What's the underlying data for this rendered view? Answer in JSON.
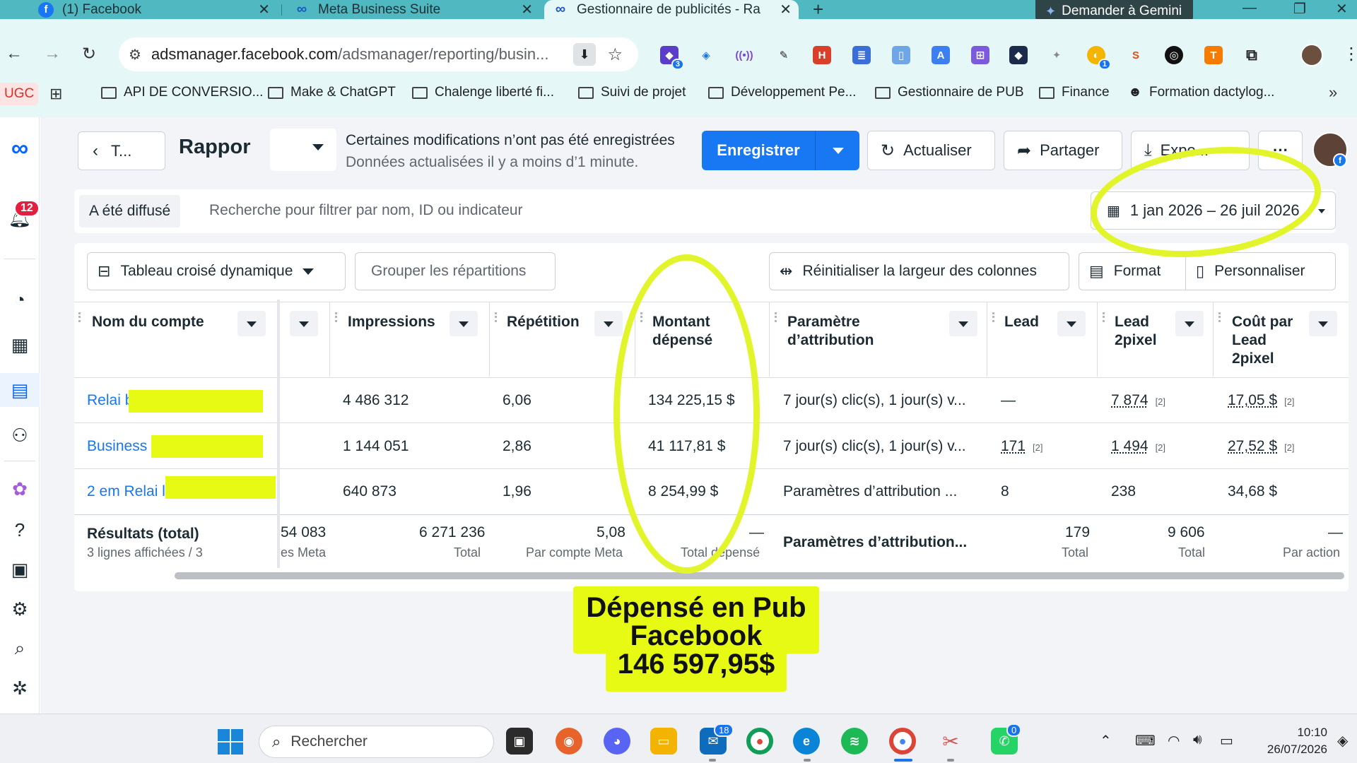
{
  "browser": {
    "tabs": [
      {
        "label": "(1) Facebook",
        "icon": "facebook-icon"
      },
      {
        "label": "Meta Business Suite",
        "icon": "meta-icon"
      },
      {
        "label": "Gestionnaire de publicités - Rap",
        "icon": "meta-icon"
      }
    ],
    "gemini_label": "Demander à Gemini",
    "url_host": "adsmanager.facebook.com",
    "url_path": "/adsmanager/reporting/busin...",
    "bookmarks": [
      {
        "label": "UGC"
      },
      {
        "label": "API DE CONVERSIO..."
      },
      {
        "label": "Make & ChatGPT"
      },
      {
        "label": "Chalenge liberté fi..."
      },
      {
        "label": "Suivi de projet"
      },
      {
        "label": "Développement Pe..."
      },
      {
        "label": "Gestionnaire de PUB"
      },
      {
        "label": "Finance"
      },
      {
        "label": "Formation dactylog..."
      }
    ],
    "extension_badges": {
      "ext1": "3",
      "ext2": "1"
    }
  },
  "sidebar": {
    "notifications_badge": "12"
  },
  "header": {
    "back_label": "T...",
    "title": "Rappor",
    "unsaved_line1": "Certaines modifications n’ont pas été enregistrées",
    "unsaved_line2": "Données actualisées il y a moins d’1 minute.",
    "save_label": "Enregistrer",
    "refresh_label": "Actualiser",
    "share_label": "Partager",
    "export_label": "Expo...",
    "more_label": "···"
  },
  "filters": {
    "delivered_chip": "A été diffusé",
    "search_placeholder": "Recherche pour filtrer par nom, ID ou indicateur",
    "date_range": "1 jan 2026 – 26 juil 2026"
  },
  "toolbar": {
    "pivot_label": "Tableau croisé dynamique",
    "group_label": "Grouper les répartitions",
    "reset_width_label": "Réinitialiser la largeur des colonnes",
    "format_label": "Format",
    "customize_label": "Personnaliser"
  },
  "table": {
    "columns": [
      {
        "label": "Nom du compte"
      },
      {
        "label": ""
      },
      {
        "label": "Impressions"
      },
      {
        "label": "Répétition"
      },
      {
        "label": "Montant dépensé"
      },
      {
        "label": "Paramètre d’attribution"
      },
      {
        "label": "Lead"
      },
      {
        "label": "Lead 2pixel"
      },
      {
        "label": "Coût par Lead 2pixel"
      }
    ],
    "rows": [
      {
        "name": "Relai b",
        "impressions": "4 486 312",
        "repetition": "6,06",
        "spent": "134 225,15 $",
        "attribution": "7 jour(s) clic(s), 1 jour(s) v...",
        "lead": "—",
        "lead_note": "",
        "lead2": "7 874",
        "lead2_note": "[2]",
        "cost": "17,05 $",
        "cost_note": "[2]"
      },
      {
        "name": "Business",
        "impressions": "1 144 051",
        "repetition": "2,86",
        "spent": "41 117,81 $",
        "attribution": "7 jour(s) clic(s), 1 jour(s) v...",
        "lead": "171",
        "lead_note": "[2]",
        "lead2": "1 494",
        "lead2_note": "[2]",
        "cost": "27,52 $",
        "cost_note": "[2]"
      },
      {
        "name": "2 em Relai l",
        "impressions": "640 873",
        "repetition": "1,96",
        "spent": "8 254,99 $",
        "attribution": "Paramètres d’attribution ...",
        "lead": "8",
        "lead_note": "",
        "lead2": "238",
        "lead2_note": "",
        "cost": "34,68 $",
        "cost_note": ""
      }
    ],
    "totals": {
      "label": "Résultats (total)",
      "sublabel": "3 lignes affichées / 3",
      "col1_value": "54 083",
      "col1_sub": "es Meta",
      "impressions": "6 271 236",
      "impressions_sub": "Total",
      "repetition": "5,08",
      "repetition_sub": "Par compte Meta",
      "spent": "—",
      "spent_sub": "Total dépensé",
      "attribution": "Paramètres d’attribution...",
      "lead": "179",
      "lead_sub": "Total",
      "lead2": "9 606",
      "lead2_sub": "Total",
      "cost": "—",
      "cost_sub": "Par action"
    }
  },
  "annotation": {
    "line1": "Dépensé en Pub",
    "line2": "Facebook",
    "line3": "146 597,95$",
    "color": "#e6fa14"
  },
  "taskbar": {
    "search_placeholder": "Rechercher",
    "badge_outlook": "18",
    "badge_whatsapp": "0",
    "time": "10:10",
    "date": "26/07/2026"
  }
}
